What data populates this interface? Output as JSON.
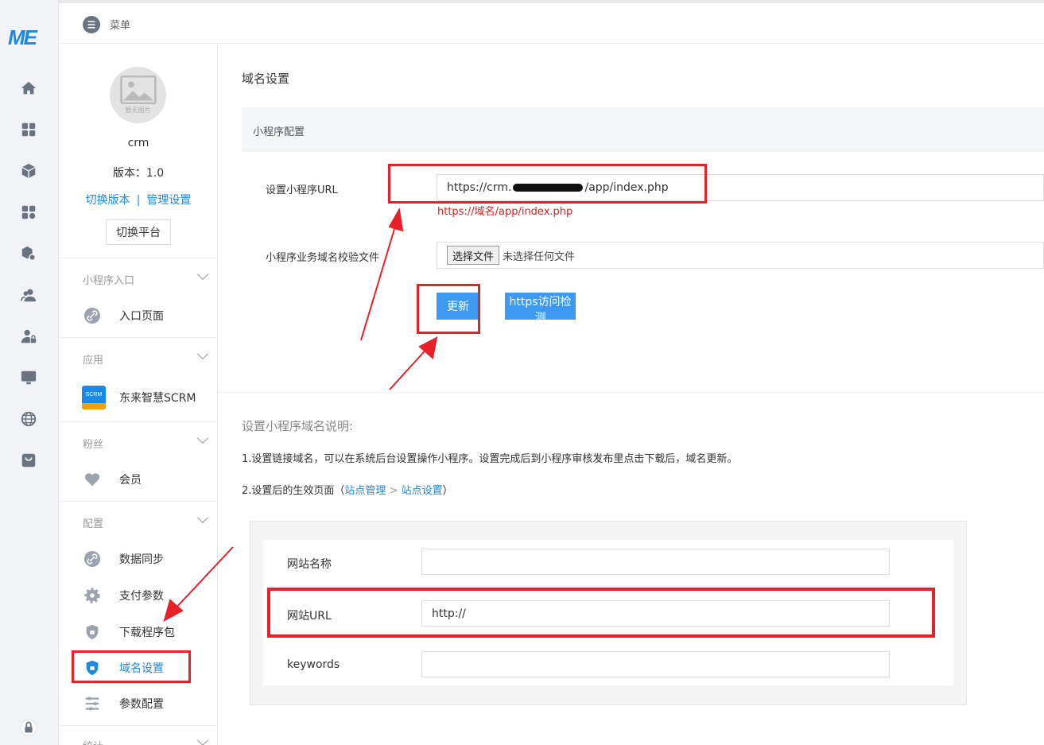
{
  "logo": {
    "text": "ME"
  },
  "rail": {
    "icons": [
      "home-icon",
      "apps-grid-icon",
      "cube-icon",
      "app-add-icon",
      "package-settings-icon",
      "users-icon",
      "user-lock-icon",
      "monitor-icon",
      "globe-icon",
      "mini-program-icon",
      "lock-icon"
    ]
  },
  "topbar": {
    "menu_label": "菜单"
  },
  "sidebar": {
    "avatar_caption": "暂无图片",
    "app_name": "crm",
    "version": "版本：1.0",
    "switch_version": "切换版本",
    "separator": "|",
    "manage_settings": "管理设置",
    "switch_platform": "切换平台",
    "groups": [
      {
        "title": "小程序入口",
        "items": [
          {
            "label": "入口页面",
            "icon": "link-icon"
          }
        ]
      },
      {
        "title": "应用",
        "items": [
          {
            "label": "东来智慧SCRM",
            "icon": "scrm-app-icon",
            "badge": "SCRM"
          }
        ]
      },
      {
        "title": "粉丝",
        "items": [
          {
            "label": "会员",
            "icon": "heart-icon"
          }
        ]
      },
      {
        "title": "配置",
        "items": [
          {
            "label": "数据同步",
            "icon": "link-icon"
          },
          {
            "label": "支付参数",
            "icon": "gear-icon"
          },
          {
            "label": "下载程序包",
            "icon": "shield-icon"
          },
          {
            "label": "域名设置",
            "icon": "shield-icon",
            "active": true
          },
          {
            "label": "参数配置",
            "icon": "sliders-icon"
          }
        ]
      },
      {
        "title": "统计",
        "items": []
      }
    ]
  },
  "main": {
    "page_title": "域名设置",
    "section_title": "小程序配置",
    "url_label": "设置小程序URL",
    "url_value_prefix": "https://crm.",
    "url_value_suffix": "/app/index.php",
    "url_hint": "https://域名/app/index.php",
    "verify_label": "小程序业务域名校验文件",
    "file_button": "选择文件",
    "file_status": "未选择任何文件",
    "update_button": "更新",
    "https_check_button": "https访问检测",
    "explain_title": "设置小程序域名说明:",
    "explain_1": "1.设置链接域名，可以在系统后台设置操作小程序。设置完成后到小程序审核发布里点击下载后，域名更新。",
    "explain_2_prefix": "2.设置后的生效页面（",
    "explain_2_link1": "站点管理",
    "explain_2_arrow": ">",
    "explain_2_link2": "站点设置",
    "explain_2_suffix": "）",
    "preview": {
      "site_name_label": "网站名称",
      "site_name_value": "",
      "site_url_label": "网站URL",
      "site_url_value": "http://",
      "keywords_label": "keywords",
      "keywords_value": ""
    }
  },
  "colors": {
    "accent": "#1e88e5",
    "button": "#3d9af2",
    "annotation": "#e8202a",
    "hint": "#e02020"
  }
}
